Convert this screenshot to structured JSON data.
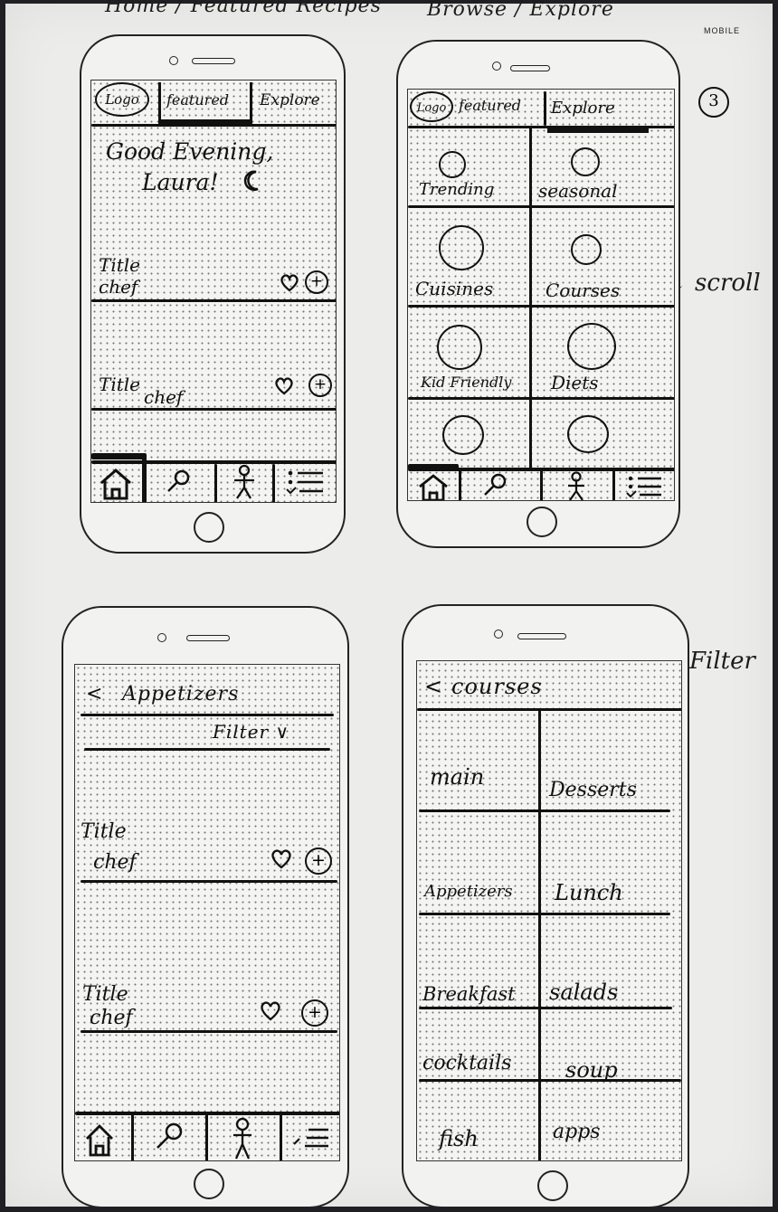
{
  "sheet": {
    "heading_home": "Home / Featured Recipes",
    "heading_browse": "Browse / Explore",
    "mobile_label": "MOBILE",
    "page_number": "3",
    "scroll_note": "↓ scroll",
    "filter_note": "Filter"
  },
  "screen_home": {
    "tabs": {
      "logo": "Logo",
      "featured": "featured",
      "explore": "Explore"
    },
    "greeting_line1": "Good Evening,",
    "greeting_line2": "Laura!",
    "cards": [
      {
        "title": "Title",
        "chef": "chef"
      },
      {
        "title": "Title",
        "chef": "chef"
      }
    ]
  },
  "screen_browse": {
    "tabs": {
      "logo": "Logo",
      "featured": "featured",
      "explore": "Explore"
    },
    "categories": [
      "Trending",
      "seasonal",
      "Cuisines",
      "Courses",
      "Kid Friendly",
      "Diets",
      "",
      ""
    ]
  },
  "screen_appetizers": {
    "back": "<",
    "title": "Appetizers",
    "filter": "Filter ∨",
    "cards": [
      {
        "title": "Title",
        "chef": "chef"
      },
      {
        "title": "Title",
        "chef": "chef"
      }
    ]
  },
  "screen_courses": {
    "back": "<",
    "title": "courses",
    "items": [
      "main",
      "Desserts",
      "Appetizers",
      "Lunch",
      "Breakfast",
      "salads",
      "cocktails",
      "soup",
      "fish",
      "apps"
    ]
  },
  "icons": {
    "home": "home-icon",
    "search": "search-icon",
    "profile": "person-icon",
    "list": "list-icon",
    "heart": "heart-icon",
    "add": "plus-circle-icon",
    "moon": "moon-icon"
  }
}
